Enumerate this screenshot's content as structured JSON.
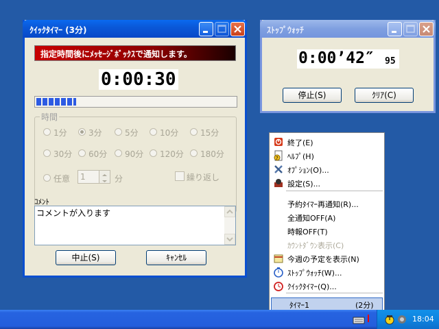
{
  "quick_timer": {
    "title": "ｸｲｯｸﾀｲﾏｰ (3分)",
    "banner": "指定時間後にﾒｯｾｰｼﾞﾎﾞｯｸｽで通知します。",
    "time": "0:00:30",
    "progress": 0.2,
    "group_label": "時間",
    "options_row1": [
      "1分",
      "3分",
      "5分",
      "10分",
      "15分"
    ],
    "options_row2": [
      "30分",
      "60分",
      "90分",
      "120分",
      "180分"
    ],
    "selected_option": "3分",
    "custom_label": "任意",
    "custom_value": "1",
    "custom_unit": "分",
    "repeat_label": "繰り返し",
    "comment_label": "ｺﾒﾝﾄ",
    "comment_text": "コメントが入ります",
    "stop_button": "中止(S)",
    "cancel_button": "ｷｬﾝｾﾙ"
  },
  "stopwatch": {
    "title": "ｽﾄｯﾌﾟｳｫｯﾁ",
    "time": "0:00’42″",
    "hundredths": "95",
    "stop_button": "停止(S)",
    "clear_button": "ｸﾘｱ(C)"
  },
  "context_menu": {
    "items": [
      {
        "label": "終了(E)",
        "icon": "power-icon"
      },
      {
        "label": "ﾍﾙﾌﾟ(H)",
        "icon": "help-icon"
      },
      {
        "label": "ｵﾌﾟｼｮﾝ(O)...",
        "icon": "tools-icon"
      },
      {
        "label": "設定(S)...",
        "icon": "settings-icon"
      },
      {
        "label": "予約ﾀｲﾏｰ再通知(R)..."
      },
      {
        "label": "全通知OFF(A)"
      },
      {
        "label": "時報OFF(T)"
      },
      {
        "label": "ｶｳﾝﾄﾀﾞｳﾝ表示(C)",
        "disabled": true
      },
      {
        "label": "今週の予定を表示(N)",
        "icon": "calendar-icon"
      },
      {
        "label": "ｽﾄｯﾌﾟｳｫｯﾁ(W)...",
        "icon": "stopwatch-icon"
      },
      {
        "label": "ｸｲｯｸﾀｲﾏｰ(Q)...",
        "icon": "alarm-clock-icon"
      }
    ],
    "timer_entry": {
      "label": "ﾀｲﾏｰ1",
      "duration": "(2分)"
    }
  },
  "taskbar": {
    "clock": "18:04"
  },
  "colors": {
    "desktop": "#235aa6",
    "banner_red": "#c80000",
    "menu_highlight": "#c1d2ee"
  }
}
